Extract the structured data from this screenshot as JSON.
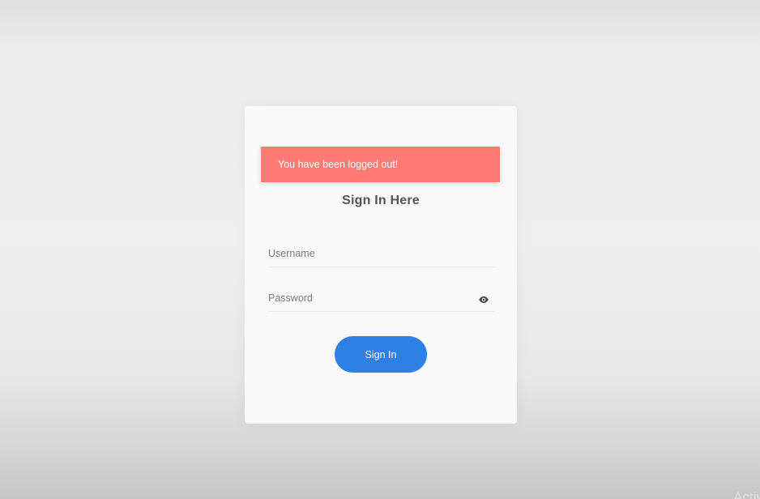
{
  "alert": {
    "message": "You have been logged out!",
    "color": "#ff7b74"
  },
  "form": {
    "title": "Sign In Here",
    "username": {
      "placeholder": "Username",
      "value": ""
    },
    "password": {
      "placeholder": "Password",
      "value": ""
    },
    "toggle_icon": "eye-icon",
    "submit_label": "Sign In",
    "accent_color": "#2f7fe4"
  },
  "watermark": {
    "text": "Activ"
  }
}
